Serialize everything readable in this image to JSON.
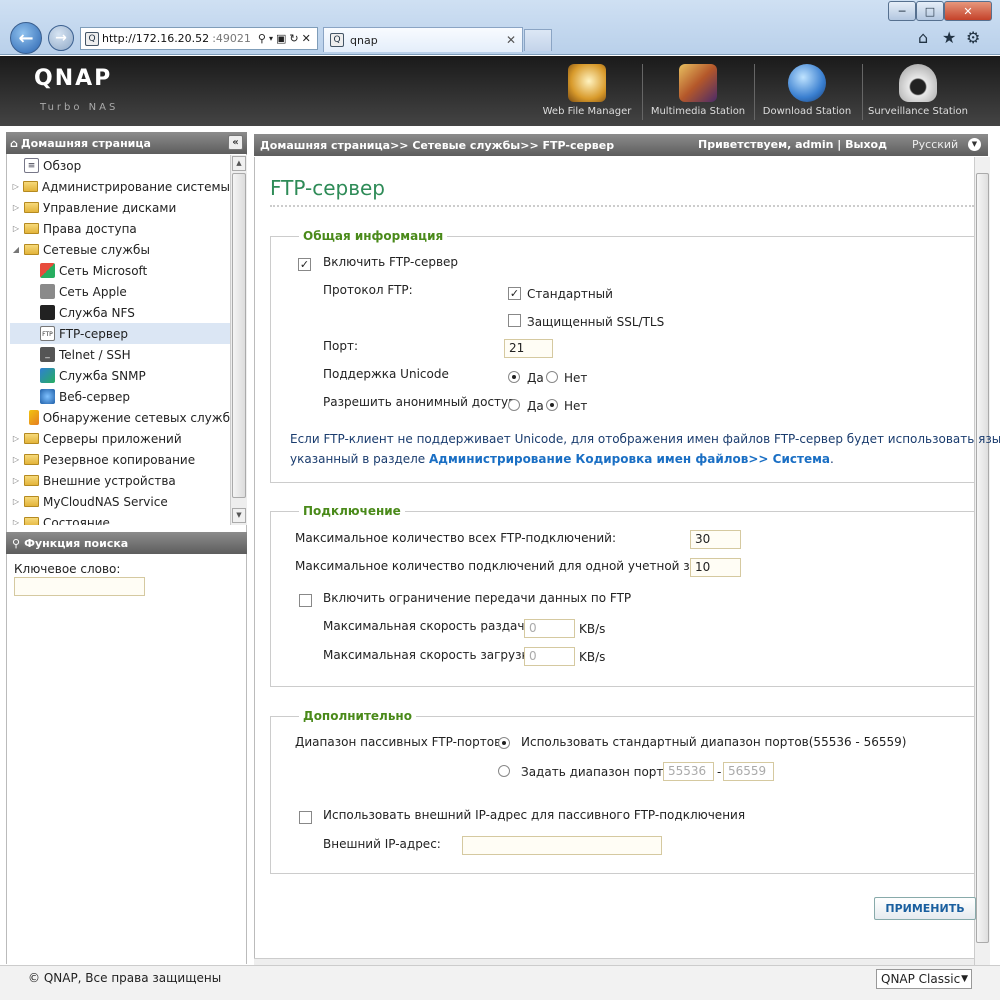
{
  "browser": {
    "address_main": "http://172.16.20.52",
    "address_dim": ":49021",
    "tab_title": "qnap",
    "min_glyph": "─",
    "max_glyph": "□",
    "close_glyph": "✕"
  },
  "header": {
    "logo": "QNAP",
    "subtitle": "Turbo NAS",
    "stations": [
      {
        "label": "Web File Manager",
        "color": "#d89a2b"
      },
      {
        "label": "Multimedia Station",
        "color": "#b4572a"
      },
      {
        "label": "Download Station",
        "color": "#3a7fd0"
      },
      {
        "label": "Surveillance Station",
        "color": "#e9e9e9"
      }
    ]
  },
  "left": {
    "header": "Домашняя страница",
    "collapse": "«",
    "tree": [
      {
        "label": "Обзор",
        "type": "item"
      },
      {
        "label": "Администрирование системы",
        "type": "folder"
      },
      {
        "label": "Управление дисками",
        "type": "folder"
      },
      {
        "label": "Права доступа",
        "type": "folder"
      },
      {
        "label": "Сетевые службы",
        "type": "folder-open"
      },
      {
        "label": "Сеть Microsoft",
        "type": "child"
      },
      {
        "label": "Сеть Apple",
        "type": "child"
      },
      {
        "label": "Служба NFS",
        "type": "child"
      },
      {
        "label": "FTP-сервер",
        "type": "child-selected"
      },
      {
        "label": "Telnet / SSH",
        "type": "child"
      },
      {
        "label": "Служба SNMP",
        "type": "child"
      },
      {
        "label": "Веб-сервер",
        "type": "child"
      },
      {
        "label": "Обнаружение сетевых служб",
        "type": "child"
      },
      {
        "label": "Серверы приложений",
        "type": "folder"
      },
      {
        "label": "Резервное копирование",
        "type": "folder"
      },
      {
        "label": "Внешние устройства",
        "type": "folder"
      },
      {
        "label": "MyCloudNAS Service",
        "type": "folder"
      },
      {
        "label": "Состояние",
        "type": "folder"
      }
    ],
    "search_header": "Функция поиска",
    "keyword_label": "Ключевое слово:"
  },
  "main": {
    "breadcrumb": "Домашняя страница>> Сетевые службы>> FTP-сервер",
    "greeting": "Приветствуем,  admin | Выход",
    "language": "Русский",
    "title": "FTP-сервер",
    "general": {
      "legend": "Общая информация",
      "enable_ftp": "Включить FTP-сервер",
      "protocol_label": "Протокол FTP:",
      "protocol_standard": "Стандартный",
      "protocol_ssl": "Защищенный SSL/TLS",
      "port_label": "Порт:",
      "port_value": "21",
      "unicode_label": "Поддержка Unicode",
      "yes": "Да",
      "no": "Нет",
      "anon_label": "Разрешить анонимный доступ",
      "note_line1": "Если FTP-клиент не поддерживает Unicode, для отображения имен файлов FTP-сервер будет использовать язык,",
      "note_line2_pre": "указанный в разделе ",
      "note_link": "Администрирование Кодировка имен файлов>> Система",
      "note_line2_post": "."
    },
    "connection": {
      "legend": "Подключение",
      "max_all_label": "Максимальное количество всех FTP-подключений:",
      "max_all_value": "30",
      "max_account_label": "Максимальное количество подключений для одной учетной записи:",
      "max_account_value": "10",
      "limit_label": "Включить ограничение передачи данных по FTP",
      "upload_label": "Максимальная скорость раздачи:",
      "upload_value": "0",
      "download_label": "Максимальная скорость загрузки:",
      "download_value": "0",
      "unit": "KB/s"
    },
    "advanced": {
      "legend": "Дополнительно",
      "passive_label": "Диапазон пассивных FTP-портов:",
      "default_range": "Использовать стандартный диапазон портов(55536 - 56559)",
      "custom_range": "Задать диапазон портов:",
      "range_from": "55536",
      "range_sep": "-",
      "range_to": "56559",
      "external_ip_label": "Использовать внешний IP-адрес для пассивного FTP-подключения",
      "external_ip_field": "Внешний IP-адрес:"
    },
    "apply": "ПРИМЕНИТЬ"
  },
  "footer": {
    "copyright": "© QNAP, Все права защищены",
    "style": "QNAP Classic"
  }
}
